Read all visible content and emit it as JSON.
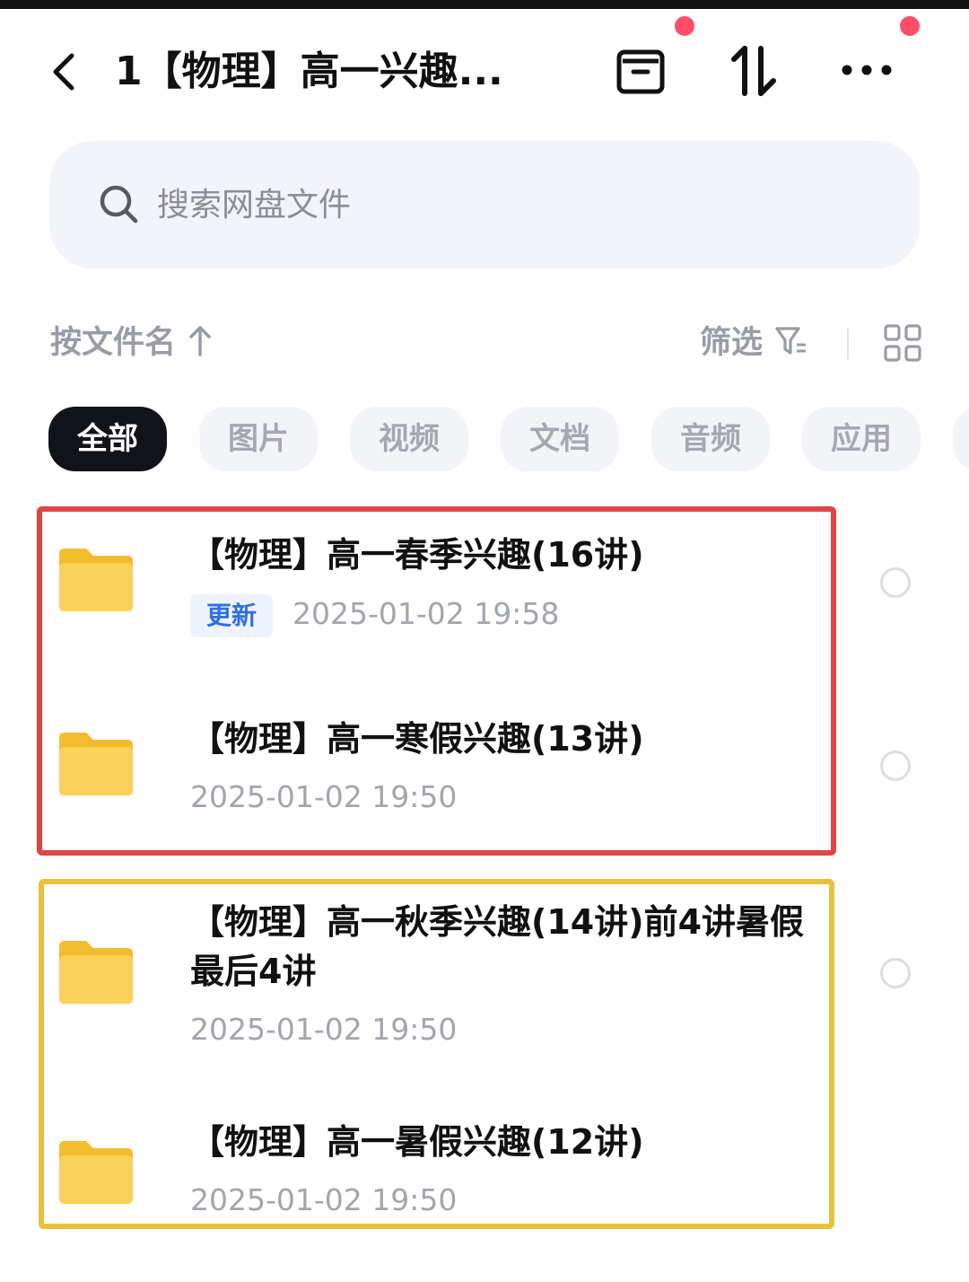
{
  "header": {
    "title": "1【物理】高一兴趣...",
    "back_icon": "chevron-left-icon",
    "icons": [
      "archive-box-icon",
      "sort-arrows-icon",
      "more-dots-icon"
    ],
    "notification_color": "#ff4d6a"
  },
  "search": {
    "placeholder": "搜索网盘文件",
    "icon": "search-icon"
  },
  "sort": {
    "label": "按文件名",
    "direction_icon": "arrow-up-icon",
    "filter_label": "筛选",
    "filter_icon": "filter-icon",
    "view_icon": "grid-view-icon"
  },
  "tabs": [
    {
      "label": "全部",
      "active": true
    },
    {
      "label": "图片",
      "active": false
    },
    {
      "label": "视频",
      "active": false
    },
    {
      "label": "文档",
      "active": false
    },
    {
      "label": "音频",
      "active": false
    },
    {
      "label": "应用",
      "active": false
    }
  ],
  "files": [
    {
      "name": "【物理】高一春季兴趣(16讲)",
      "badge": "更新",
      "date": "2025-01-02 19:58",
      "icon": "folder-icon"
    },
    {
      "name": "【物理】高一寒假兴趣(13讲)",
      "badge": "",
      "date": "2025-01-02 19:50",
      "icon": "folder-icon"
    },
    {
      "name": "【物理】高一秋季兴趣(14讲)前4讲暑假最后4讲",
      "badge": "",
      "date": "2025-01-02 19:50",
      "icon": "folder-icon"
    },
    {
      "name": "【物理】高一暑假兴趣(12讲)",
      "badge": "",
      "date": "2025-01-02 19:50",
      "icon": "folder-icon"
    }
  ],
  "colors": {
    "folder": "#f7ca45",
    "highlight_red": "#e04545",
    "highlight_yellow": "#e8c23c",
    "active_tab": "#111319",
    "badge_text": "#2f6fe0"
  }
}
